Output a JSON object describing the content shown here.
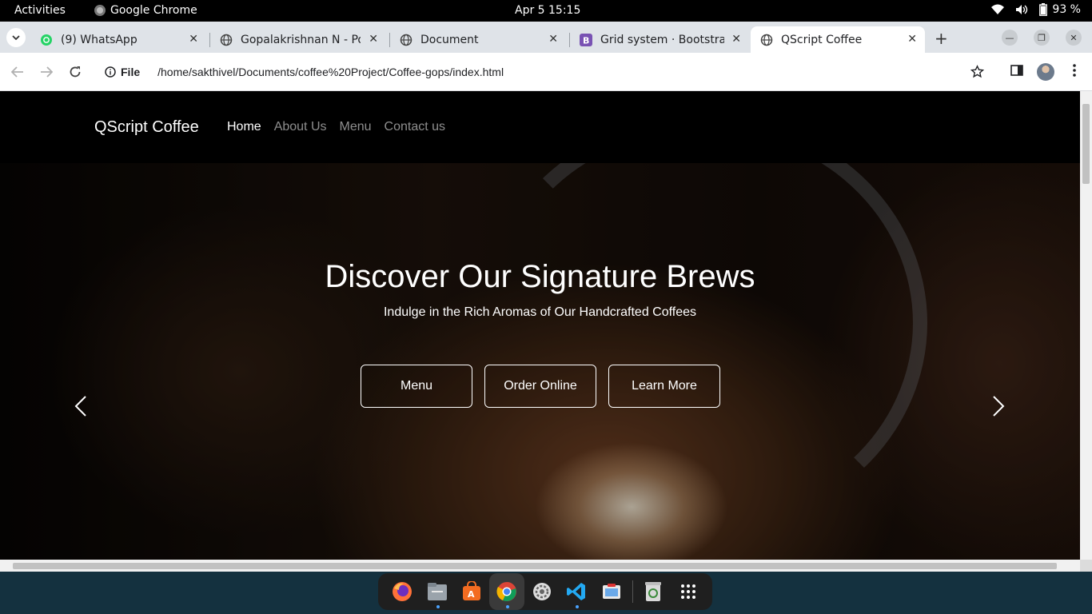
{
  "system": {
    "activities": "Activities",
    "app_name": "Google Chrome",
    "clock": "Apr 5  15:15",
    "battery": "93 %"
  },
  "tabs": [
    {
      "title": "(9) WhatsApp",
      "icon": "whatsapp-icon",
      "active": false
    },
    {
      "title": "Gopalakrishnan N - Por",
      "icon": "globe-icon",
      "active": false
    },
    {
      "title": "Document",
      "icon": "globe-icon",
      "active": false
    },
    {
      "title": "Grid system · Bootstrap",
      "icon": "bootstrap-icon",
      "active": false
    },
    {
      "title": "QScript Coffee",
      "icon": "globe-icon",
      "active": true
    }
  ],
  "omnibox": {
    "scheme_label": "File",
    "url": "/home/sakthivel/Documents/coffee%20Project/Coffee-gops/index.html"
  },
  "site": {
    "brand": "QScript Coffee",
    "nav": [
      "Home",
      "About Us",
      "Menu",
      "Contact us"
    ],
    "active_nav": "Home",
    "hero_title": "Discover Our Signature Brews",
    "hero_subtitle": "Indulge in the Rich Aromas of Our Handcrafted Coffees",
    "buttons": [
      "Menu",
      "Order Online",
      "Learn More"
    ]
  },
  "dock": [
    "firefox-icon",
    "files-icon",
    "app-center-icon",
    "chrome-icon",
    "settings-icon",
    "vscode-icon",
    "screenshot-icon",
    "trash-icon",
    "app-grid-icon"
  ],
  "colors": {
    "tabstrip": "#dfe3e8",
    "page_bg": "#000000",
    "dock_bg": "#1f1f1f",
    "desktop_bg": "#14313f"
  }
}
